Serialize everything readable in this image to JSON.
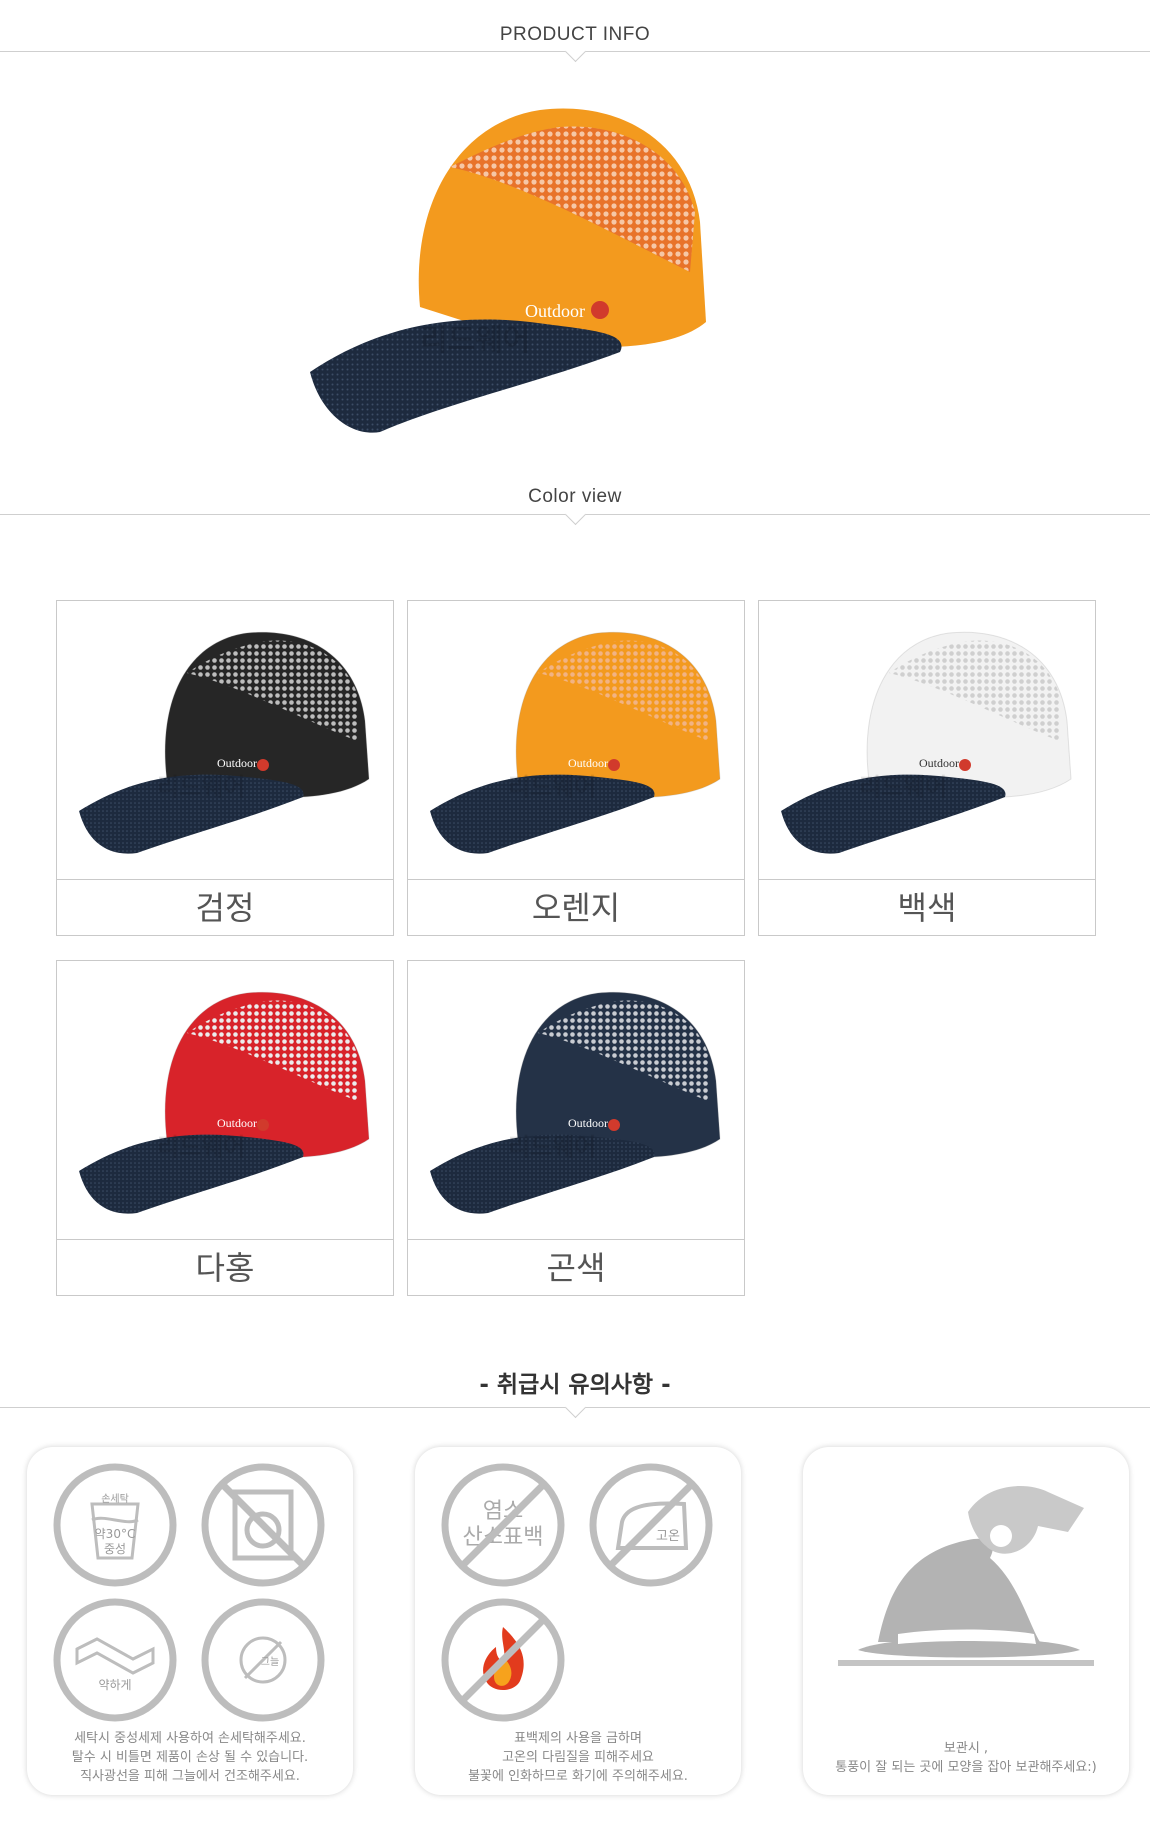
{
  "header": {
    "title": "PRODUCT INFO"
  },
  "color_section": {
    "title": "Color view"
  },
  "product": {
    "logo_text": "Outdoor",
    "watermark": "리드웨어"
  },
  "colors": [
    {
      "label": "검정",
      "crown": "#262626",
      "mesh": "#bdbdbd"
    },
    {
      "label": "오렌지",
      "crown": "#f39a1e",
      "mesh": "#f2b383"
    },
    {
      "label": "백색",
      "crown": "#f2f2f2",
      "mesh": "#cfcfcf"
    },
    {
      "label": "다홍",
      "crown": "#d8232a",
      "mesh": "#ececec"
    },
    {
      "label": "곤색",
      "crown": "#243247",
      "mesh": "#c9ccd2"
    }
  ],
  "care": {
    "title": "-  취급시 유의사항 -",
    "wash_icon": {
      "top": "손세탁",
      "temp": "약30°C",
      "bottom": "중성"
    },
    "twist_label": "약하게",
    "shade_label": "그늘",
    "bleach_text_1": "염소",
    "bleach_text_2": "산소표백",
    "iron_label": "고온",
    "card1_lines": [
      "세탁시 중성세제 사용하여 손세탁해주세요.",
      "탈수 시 비틀면 제품이 손상 될 수 있습니다.",
      "직사광선을 피해 그늘에서 건조해주세요."
    ],
    "card2_lines": [
      "표백제의 사용을 금하며",
      "고온의 다림질을 피해주세요",
      "불꽃에 인화하므로 화기에 주의해주세요."
    ],
    "card3_lines": [
      "보관시 ,",
      "통풍이 잘 되는 곳에 모양을 잡아 보관해주세요:)"
    ]
  }
}
